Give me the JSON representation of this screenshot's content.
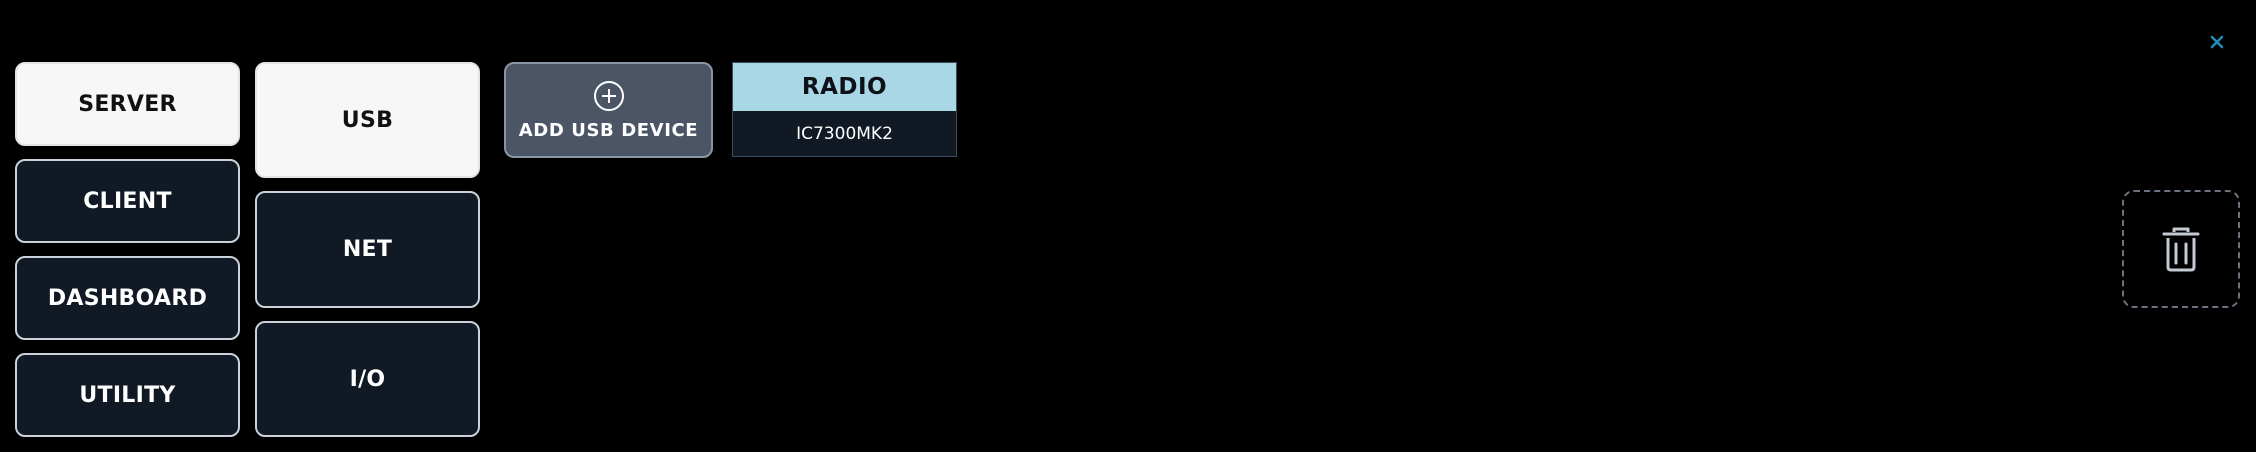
{
  "left_nav": {
    "items": [
      {
        "label": "SERVER",
        "active": true
      },
      {
        "label": "CLIENT",
        "active": false
      },
      {
        "label": "DASHBOARD",
        "active": false
      },
      {
        "label": "UTILITY",
        "active": false
      }
    ]
  },
  "sub_nav": {
    "items": [
      {
        "label": "USB",
        "active": true
      },
      {
        "label": "NET",
        "active": false
      },
      {
        "label": "I/O",
        "active": false
      }
    ]
  },
  "toolbar": {
    "add_usb_label": "ADD USB DEVICE",
    "add_icon": "plus-circle-icon"
  },
  "devices": [
    {
      "name": "RADIO",
      "model": "IC7300MK2"
    }
  ],
  "window": {
    "close_icon": "close-icon"
  },
  "trash": {
    "icon": "trash-icon"
  },
  "colors": {
    "background": "#000000",
    "active_button": "#f7f7f7",
    "idle_button": "#101924",
    "device_header": "#a9d7e6",
    "add_button": "#4b5566",
    "close_accent": "#1f8fb8"
  }
}
